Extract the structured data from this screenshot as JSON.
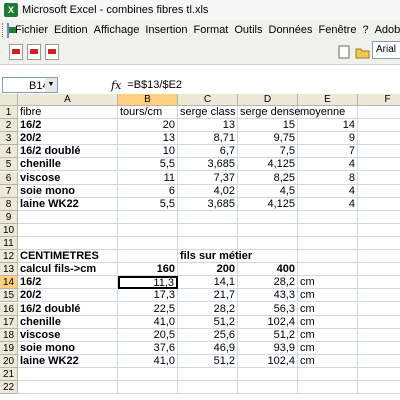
{
  "window": {
    "title": "Microsoft Excel - combines fibres tl.xls",
    "app_icon": "excel-icon"
  },
  "menu": {
    "items": [
      "Fichier",
      "Edition",
      "Affichage",
      "Insertion",
      "Format",
      "Outils",
      "Données",
      "Fenêtre",
      "?",
      "Adobe"
    ]
  },
  "toolbar": {
    "font_name": "Arial"
  },
  "formula_bar": {
    "name_box": "B14",
    "fx": "fx",
    "formula": "=B$13/$E2"
  },
  "columns": [
    "A",
    "B",
    "C",
    "D",
    "E",
    "F"
  ],
  "rows": [
    {
      "n": "1",
      "cells": [
        "fibre",
        "tours/cm",
        "serge class",
        "serge dense",
        "moyenne",
        ""
      ]
    },
    {
      "n": "2",
      "cells": [
        "16/2",
        "20",
        "13",
        "15",
        "14",
        ""
      ]
    },
    {
      "n": "3",
      "cells": [
        "20/2",
        "13",
        "8,71",
        "9,75",
        "9",
        ""
      ]
    },
    {
      "n": "4",
      "cells": [
        "16/2 doublé",
        "10",
        "6,7",
        "7,5",
        "7",
        ""
      ]
    },
    {
      "n": "5",
      "cells": [
        "chenille",
        "5,5",
        "3,685",
        "4,125",
        "4",
        ""
      ]
    },
    {
      "n": "6",
      "cells": [
        "viscose",
        "11",
        "7,37",
        "8,25",
        "8",
        ""
      ]
    },
    {
      "n": "7",
      "cells": [
        "soie mono",
        "6",
        "4,02",
        "4,5",
        "4",
        ""
      ]
    },
    {
      "n": "8",
      "cells": [
        "laine WK22",
        "5,5",
        "3,685",
        "4,125",
        "4",
        ""
      ]
    },
    {
      "n": "9",
      "cells": [
        "",
        "",
        "",
        "",
        "",
        ""
      ]
    },
    {
      "n": "10",
      "cells": [
        "",
        "",
        "",
        "",
        "",
        ""
      ]
    },
    {
      "n": "11",
      "cells": [
        "",
        "",
        "",
        "",
        "",
        ""
      ]
    },
    {
      "n": "12",
      "cells": [
        "CENTIMETRES",
        "",
        "fils sur métier",
        "",
        "",
        ""
      ]
    },
    {
      "n": "13",
      "cells": [
        "calcul fils->cm",
        "160",
        "200",
        "400",
        "",
        ""
      ]
    },
    {
      "n": "14",
      "cells": [
        "16/2",
        "11,3",
        "14,1",
        "28,2",
        "cm",
        ""
      ]
    },
    {
      "n": "15",
      "cells": [
        "20/2",
        "17,3",
        "21,7",
        "43,3",
        "cm",
        ""
      ]
    },
    {
      "n": "16",
      "cells": [
        "16/2 doublé",
        "22,5",
        "28,2",
        "56,3",
        "cm",
        ""
      ]
    },
    {
      "n": "17",
      "cells": [
        "chenille",
        "41,0",
        "51,2",
        "102,4",
        "cm",
        ""
      ]
    },
    {
      "n": "18",
      "cells": [
        "viscose",
        "20,5",
        "25,6",
        "51,2",
        "cm",
        ""
      ]
    },
    {
      "n": "19",
      "cells": [
        "soie mono",
        "37,6",
        "46,9",
        "93,9",
        "cm",
        ""
      ]
    },
    {
      "n": "20",
      "cells": [
        "laine WK22",
        "41,0",
        "51,2",
        "102,4",
        "cm",
        ""
      ]
    },
    {
      "n": "21",
      "cells": [
        "",
        "",
        "",
        "",
        "",
        ""
      ]
    },
    {
      "n": "22",
      "cells": [
        "",
        "",
        "",
        "",
        "",
        ""
      ]
    }
  ]
}
